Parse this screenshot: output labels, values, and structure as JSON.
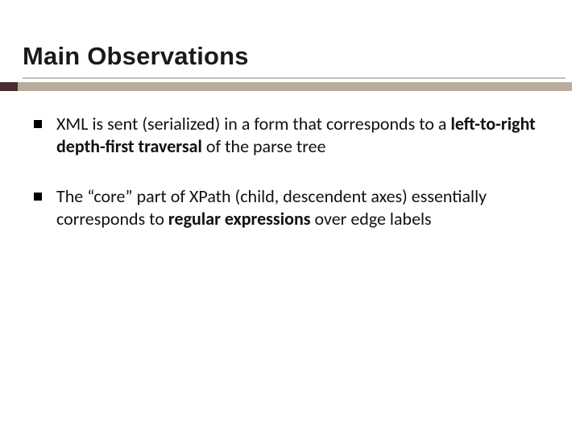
{
  "title": "Main Observations",
  "bullets": [
    {
      "parts": {
        "p0": "XML is sent (serialized) in a form that corresponds to a ",
        "p1": "left-to-right depth-first traversal",
        "p2": " of the parse tree"
      }
    },
    {
      "parts": {
        "p0": "The “core” part of XPath (child, descendent axes) essentially corresponds to ",
        "p1": "regular expressions",
        "p2": " over edge labels"
      }
    }
  ]
}
